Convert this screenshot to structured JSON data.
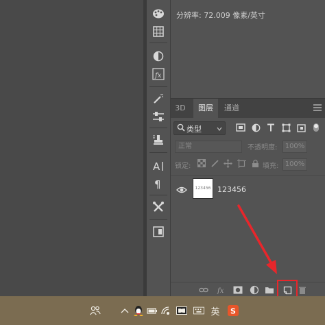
{
  "info_panel": {
    "resolution": "分辨率: 72.009 像素/英寸"
  },
  "layers_panel": {
    "tabs": [
      {
        "label": "3D",
        "active": false
      },
      {
        "label": "图层",
        "active": true
      },
      {
        "label": "通道",
        "active": false
      }
    ],
    "filter_kind": "类型",
    "blend_mode": "正常",
    "opacity_label": "不透明度:",
    "opacity_value": "100%",
    "lock_label": "锁定:",
    "fill_label": "填充:",
    "fill_value": "100%",
    "layer": {
      "name": "123456",
      "thumbnail_text": "123456",
      "visible": true
    }
  },
  "taskbar": {
    "ime_label": "英"
  },
  "colors": {
    "annotation_red": "#e8262b",
    "panel_bg": "#535353",
    "canvas_bg": "#494949",
    "taskbar_bg": "#7b6c51"
  },
  "icons": {
    "tool_strip": [
      "palette-icon",
      "grid-icon",
      "adjustment-icon",
      "fx-icon",
      "brush-settings-icon",
      "slider-icon",
      "clone-stamp-icon",
      "character-icon",
      "paragraph-icon",
      "tools-icon",
      "panel-icon"
    ],
    "bottom_bar": [
      "link-icon",
      "fx-icon",
      "mask-icon",
      "adjustment-layer-icon",
      "folder-icon",
      "new-layer-icon",
      "trash-icon"
    ]
  }
}
